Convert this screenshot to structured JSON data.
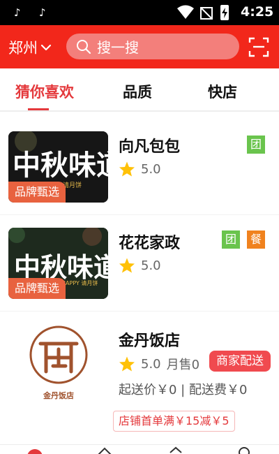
{
  "status_bar": {
    "time": "4:25",
    "left_icons": [
      "tiktok-icon",
      "tiktok-icon"
    ],
    "right_icons": [
      "wifi-icon",
      "no-signal-icon",
      "battery-icon"
    ]
  },
  "header": {
    "city": "郑州",
    "search_placeholder": "搜一搜",
    "background_color": "#f2271b"
  },
  "tabs": [
    {
      "label": "猜你喜欢",
      "active": true
    },
    {
      "label": "品质",
      "active": false
    },
    {
      "label": "快店",
      "active": false
    }
  ],
  "stores": [
    {
      "name": "向凡包包",
      "rating": "5.0",
      "image_tag": "品牌甄选",
      "image_text": "中秋味道",
      "image_subtext": "请月饼",
      "badges": [
        "团"
      ]
    },
    {
      "name": "花花家政",
      "rating": "5.0",
      "image_tag": "品牌甄选",
      "image_text": "中秋味道",
      "image_subtext": "HAPPY 请月饼",
      "badges": [
        "团",
        "餐"
      ]
    },
    {
      "name": "金丹饭店",
      "rating": "5.0",
      "monthly_sales": "月售0",
      "delivery_label": "商家配送",
      "fees": "起送价￥0 | 配送费￥0",
      "promo": "店铺首单满￥15减￥5",
      "logo_text": "金丹饭店"
    }
  ],
  "colors": {
    "accent": "#e4393c",
    "badge_tuan": "#6ac44d",
    "badge_can": "#f0821e",
    "star": "#ffc107"
  }
}
